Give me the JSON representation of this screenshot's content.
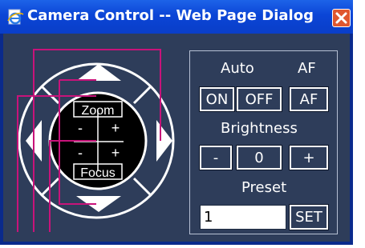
{
  "window": {
    "title": "Camera Control -- Web Page Dialog"
  },
  "pad": {
    "zoom_label": "Zoom",
    "focus_label": "Focus",
    "minus": "-",
    "plus": "+"
  },
  "panel": {
    "auto_label": "Auto",
    "af_label": "AF",
    "on_button": "ON",
    "off_button": "OFF",
    "af_button": "AF",
    "brightness_label": "Brightness",
    "brightness_minus": "-",
    "brightness_value": "0",
    "brightness_plus": "+",
    "preset_label": "Preset",
    "preset_value": "1",
    "set_button": "SET"
  },
  "colors": {
    "client_bg": "#2e3d5a",
    "titlebar": "#0b45d6",
    "annotation_lines": "#c8137a",
    "close_button": "#e0572f"
  },
  "icons": [
    "ie-page-icon",
    "close-icon",
    "arrow-up-icon",
    "arrow-down-icon",
    "arrow-left-icon",
    "arrow-right-icon"
  ]
}
